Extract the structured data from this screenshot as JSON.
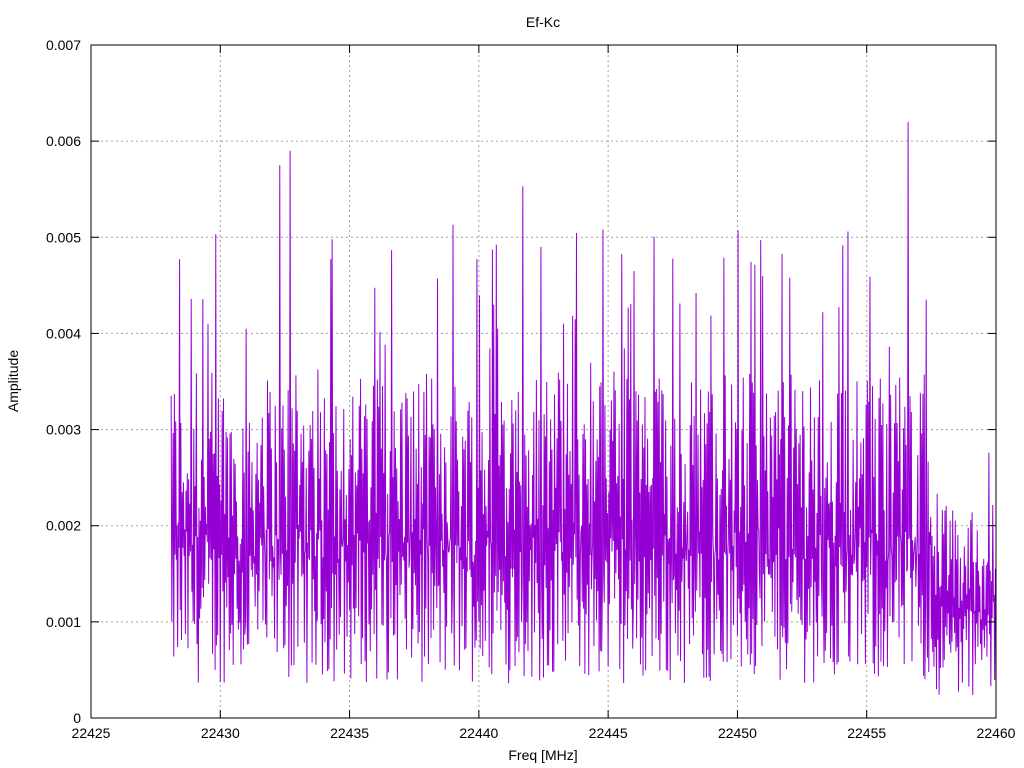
{
  "chart_data": {
    "type": "line",
    "title": "Ef-Kc",
    "xlabel": "Freq [MHz]",
    "ylabel": "Amplitude",
    "xlim": [
      22425,
      22460
    ],
    "ylim": [
      0,
      0.007
    ],
    "x_ticks": [
      "22425",
      "22430",
      "22435",
      "22440",
      "22445",
      "22450",
      "22455",
      "22460"
    ],
    "y_ticks": [
      "0",
      "0.001",
      "0.002",
      "0.003",
      "0.004",
      "0.005",
      "0.006",
      "0.007"
    ],
    "grid": true,
    "line_color": "#9400d3",
    "series": [
      {
        "x_start": 22428.1,
        "x_end": 22460,
        "x_step": 0.025,
        "noise_floor_mean": 0.0018,
        "peaks": [
          {
            "x": 22432.3,
            "y": 0.00575
          },
          {
            "x": 22432.7,
            "y": 0.0059
          },
          {
            "x": 22439.0,
            "y": 0.00513
          },
          {
            "x": 22441.7,
            "y": 0.00553
          },
          {
            "x": 22442.4,
            "y": 0.0049
          },
          {
            "x": 22444.8,
            "y": 0.00508
          },
          {
            "x": 22450.9,
            "y": 0.00497
          },
          {
            "x": 22456.6,
            "y": 0.0062
          },
          {
            "x": 22457.3,
            "y": 0.00435
          },
          {
            "x": 22438.4,
            "y": 0.00457
          },
          {
            "x": 22447.5,
            "y": 0.00478
          },
          {
            "x": 22448.4,
            "y": 0.00442
          },
          {
            "x": 22431.0,
            "y": 0.00405
          },
          {
            "x": 22428.1,
            "y": 0.00335
          },
          {
            "x": 22453.3,
            "y": 0.00422
          },
          {
            "x": 22446.0,
            "y": 0.00465
          }
        ]
      }
    ]
  }
}
